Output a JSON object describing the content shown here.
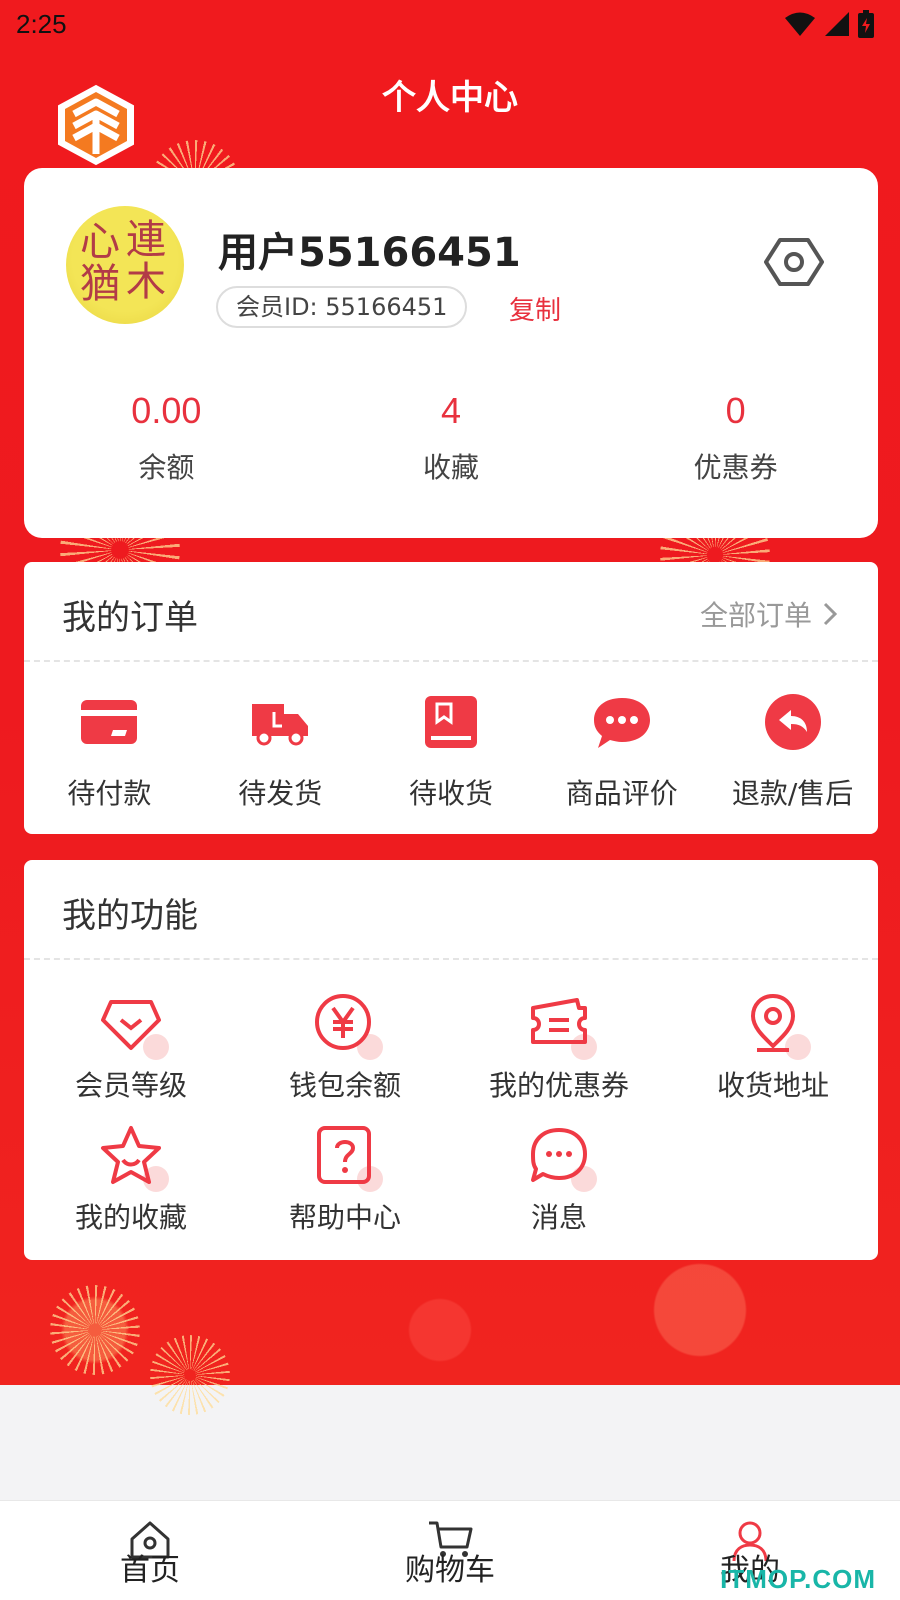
{
  "status_bar": {
    "time": "2:25"
  },
  "header": {
    "title": "个人中心"
  },
  "profile": {
    "username": "用户55166451",
    "member_id": "会员ID: 55166451",
    "copy_label": "复制",
    "avatar_chars": [
      "連",
      "木",
      "心",
      "猶"
    ]
  },
  "stats": [
    {
      "value": "0.00",
      "label": "余额"
    },
    {
      "value": "4",
      "label": "收藏"
    },
    {
      "value": "0",
      "label": "优惠券"
    }
  ],
  "orders": {
    "title": "我的订单",
    "all_label": "全部订单",
    "items": [
      {
        "label": "待付款",
        "icon": "card-icon"
      },
      {
        "label": "待发货",
        "icon": "truck-icon"
      },
      {
        "label": "待收货",
        "icon": "package-icon"
      },
      {
        "label": "商品评价",
        "icon": "chat-icon"
      },
      {
        "label": "退款/售后",
        "icon": "return-icon"
      }
    ]
  },
  "features": {
    "title": "我的功能",
    "items": [
      {
        "label": "会员等级",
        "icon": "diamond-icon"
      },
      {
        "label": "钱包余额",
        "icon": "yen-icon"
      },
      {
        "label": "我的优惠券",
        "icon": "coupon-icon"
      },
      {
        "label": "收货地址",
        "icon": "location-icon"
      },
      {
        "label": "我的收藏",
        "icon": "star-icon"
      },
      {
        "label": "帮助中心",
        "icon": "help-icon"
      },
      {
        "label": "消息",
        "icon": "message-icon"
      }
    ]
  },
  "tabbar": [
    {
      "label": "首页",
      "icon": "home-icon"
    },
    {
      "label": "购物车",
      "icon": "cart-icon"
    },
    {
      "label": "我的",
      "icon": "user-icon",
      "active": true
    }
  ],
  "watermark": "ITMOP.COM",
  "colors": {
    "brand_red": "#ee1a1f",
    "accent": "#e8313e",
    "icon_red": "#ef3a45"
  }
}
